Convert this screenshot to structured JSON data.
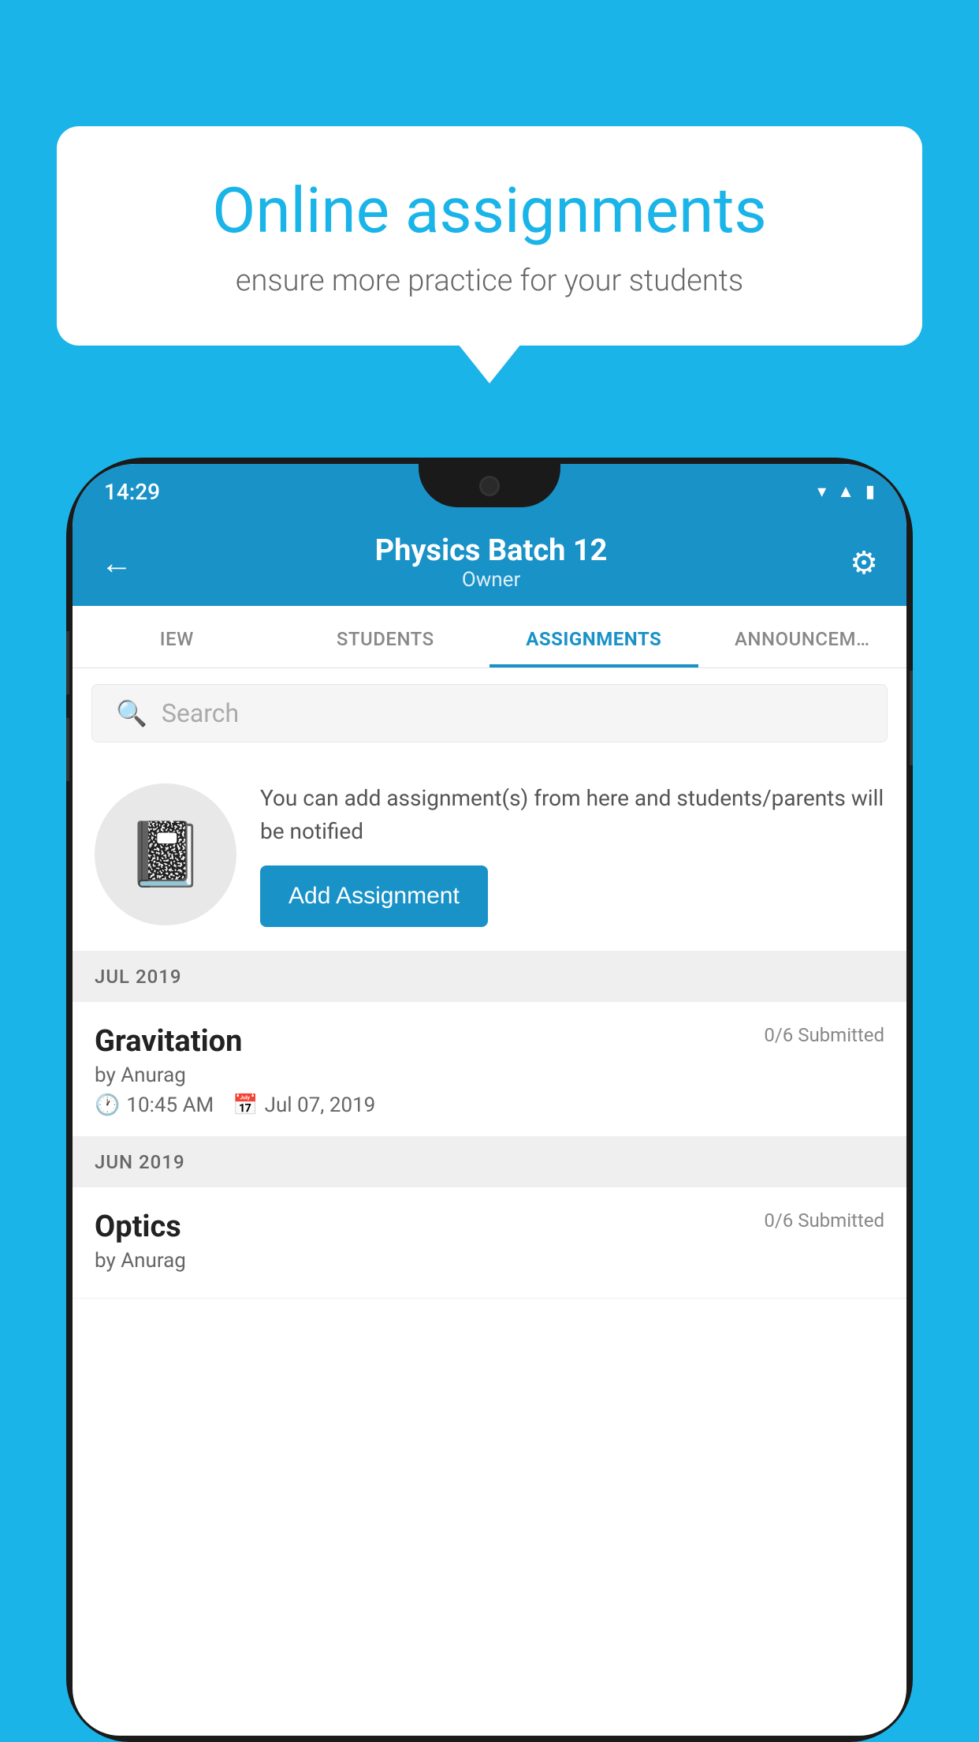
{
  "background_color": "#1ab4e8",
  "speech_bubble": {
    "title": "Online assignments",
    "subtitle": "ensure more practice for your students"
  },
  "phone": {
    "status_bar": {
      "time": "14:29",
      "icons": [
        "wifi",
        "signal",
        "battery"
      ]
    },
    "header": {
      "title": "Physics Batch 12",
      "subtitle": "Owner",
      "back_label": "←",
      "settings_label": "⚙"
    },
    "tabs": [
      {
        "label": "IEW",
        "active": false
      },
      {
        "label": "STUDENTS",
        "active": false
      },
      {
        "label": "ASSIGNMENTS",
        "active": true
      },
      {
        "label": "ANNOUNCEM…",
        "active": false
      }
    ],
    "search": {
      "placeholder": "Search"
    },
    "promo": {
      "text": "You can add assignment(s) from here and students/parents will be notified",
      "button_label": "Add Assignment"
    },
    "sections": [
      {
        "label": "JUL 2019",
        "assignments": [
          {
            "name": "Gravitation",
            "submitted": "0/6 Submitted",
            "by": "by Anurag",
            "time": "10:45 AM",
            "date": "Jul 07, 2019"
          }
        ]
      },
      {
        "label": "JUN 2019",
        "assignments": [
          {
            "name": "Optics",
            "submitted": "0/6 Submitted",
            "by": "by Anurag",
            "time": "",
            "date": ""
          }
        ]
      }
    ]
  }
}
